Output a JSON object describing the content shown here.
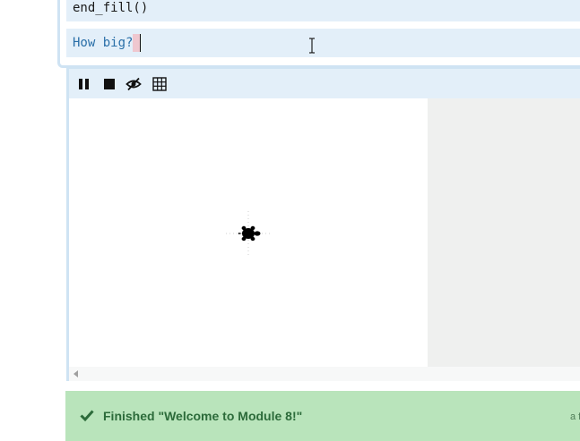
{
  "editor": {
    "code_line": "end_fill()",
    "input_prompt": "How big?"
  },
  "turtle_toolbar": {
    "buttons": [
      {
        "icon": "pause-icon"
      },
      {
        "icon": "stop-icon"
      },
      {
        "icon": "hide-icon"
      },
      {
        "icon": "grid-icon"
      }
    ]
  },
  "banner": {
    "message": "Finished \"Welcome to Module 8!\"",
    "right_text": "a f"
  },
  "colors": {
    "cell_border": "#cfe3f3",
    "cell_bg": "#e3eff9",
    "input_text": "#2a6fa8",
    "banner_bg": "#b9e4bb",
    "banner_text": "#2c6b3a",
    "canvas_gray": "#eff0ef"
  }
}
